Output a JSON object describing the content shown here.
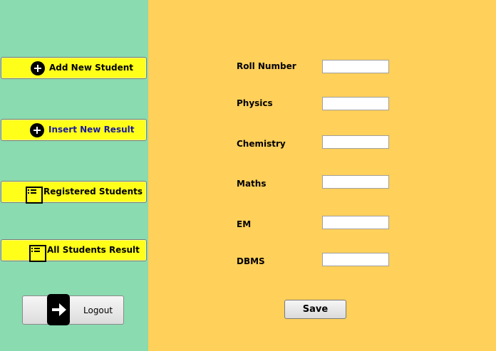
{
  "sidebar": {
    "add_student": {
      "label": "Add New Student",
      "icon": "plus-circle-icon"
    },
    "insert_result": {
      "label": "Insert New Result",
      "icon": "plus-circle-icon",
      "label_color": "#1a1aa0"
    },
    "registered_students": {
      "label": "Registered Students",
      "icon": "list-icon"
    },
    "all_results": {
      "label": "All Students Result",
      "icon": "list-icon"
    },
    "logout": {
      "label": "Logout",
      "icon": "arrow-right-icon"
    }
  },
  "form": {
    "fields": [
      {
        "label": "Roll Number",
        "value": ""
      },
      {
        "label": "Physics",
        "value": ""
      },
      {
        "label": "Chemistry",
        "value": ""
      },
      {
        "label": "Maths",
        "value": ""
      },
      {
        "label": "EM",
        "value": ""
      },
      {
        "label": "DBMS",
        "value": ""
      }
    ],
    "save_label": "Save"
  },
  "colors": {
    "sidebar_bg": "#8adbb0",
    "main_bg": "#ffd05a",
    "button_bg": "#ffff1a"
  }
}
